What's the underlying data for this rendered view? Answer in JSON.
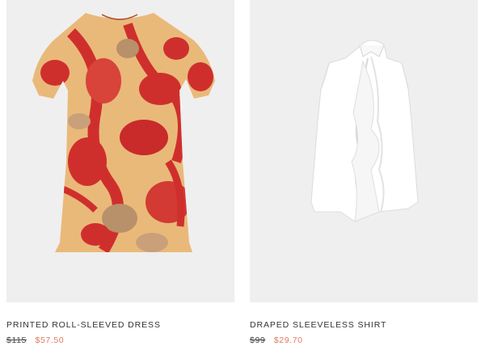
{
  "products": [
    {
      "name": "PRINTED ROLL-SLEEVED DRESS",
      "original_price": "$115",
      "sale_price": "$57.50",
      "image": "printed-roll-sleeved-dress"
    },
    {
      "name": "DRAPED SLEEVELESS SHIRT",
      "original_price": "$99",
      "sale_price": "$29.70",
      "image": "draped-sleeveless-shirt"
    }
  ],
  "colors": {
    "image_background": "#efefef",
    "sale_price": "#e07a5f",
    "dress_base": "#e9b97a",
    "dress_print": "#cf2f2c"
  }
}
